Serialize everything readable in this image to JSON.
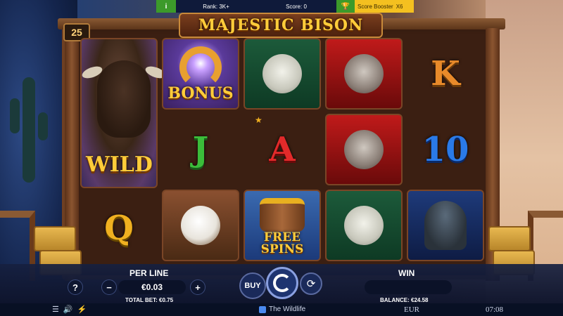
{
  "topbar": {
    "info_label": "i",
    "rank": "Rank: 3K+",
    "score": "Score: 0",
    "booster_label": "Score Booster",
    "booster_multiplier": "X6"
  },
  "title": "MAJESTIC BISON",
  "lines": "25",
  "reels": {
    "wild_label": "WILD",
    "bonus_label": "BONUS",
    "free_spins_line1": "FREE",
    "free_spins_line2": "SPINS",
    "letter_j": "J",
    "letter_a": "A",
    "letter_k": "K",
    "letter_10": "10",
    "letter_q": "Q",
    "star": "★"
  },
  "controls": {
    "per_line_label": "PER LINE",
    "per_line_value": "€0.03",
    "help": "?",
    "minus": "−",
    "plus": "+",
    "buy": "BUY",
    "win_label": "WIN",
    "total_bet": "TOTAL BET: €0.75",
    "balance": "BALANCE: €24.58",
    "auto_icon": "⟳"
  },
  "statusbar": {
    "menu_icon": "☰",
    "sound_icon": "🔊",
    "turbo_icon": "⚡",
    "brand": "The Wildlife",
    "currency": "EUR",
    "time": "07:08"
  }
}
